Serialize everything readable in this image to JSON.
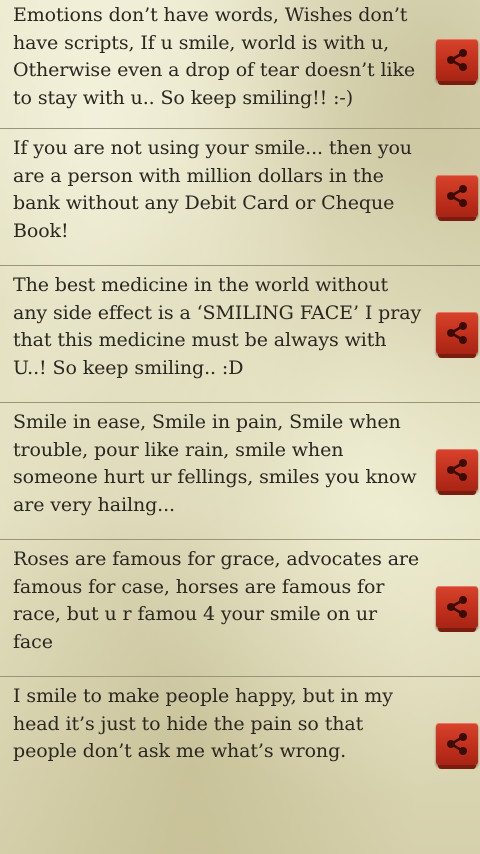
{
  "quotes": [
    {
      "text": "Emotions don’t have words, Wishes don’t have scripts, If u smile, world is with u, Otherwise even a drop of tear doesn’t like to stay with u.. So keep smiling!! :-)",
      "action_icon": "share-icon"
    },
    {
      "text": "If you are not using your smile... then you are a person with million dollars in the bank without any Debit Card or Cheque Book!",
      "action_icon": "share-icon"
    },
    {
      "text": "The best medicine in the world without any side effect is a ‘SMILING FACE’ I pray that this medicine must be always with U..! So keep smiling.. :D",
      "action_icon": "share-icon"
    },
    {
      "text": "Smile in ease, Smile in pain, Smile when trouble, pour like rain, smile when someone hurt ur fellings, smiles you know are very hailng...",
      "action_icon": "share-icon"
    },
    {
      "text": "Roses are famous for grace, advocates are famous for case, horses are famous for race, but u r famou 4 your smile on ur face",
      "action_icon": "share-icon"
    },
    {
      "text": "I smile to make people happy, but in my head it’s just to hide the pain so that people don’t ask me what’s wrong.",
      "action_icon": "share-icon"
    }
  ],
  "colors": {
    "share_button": "#c0301c",
    "text": "#2a2620",
    "divider": "#9a9478"
  }
}
